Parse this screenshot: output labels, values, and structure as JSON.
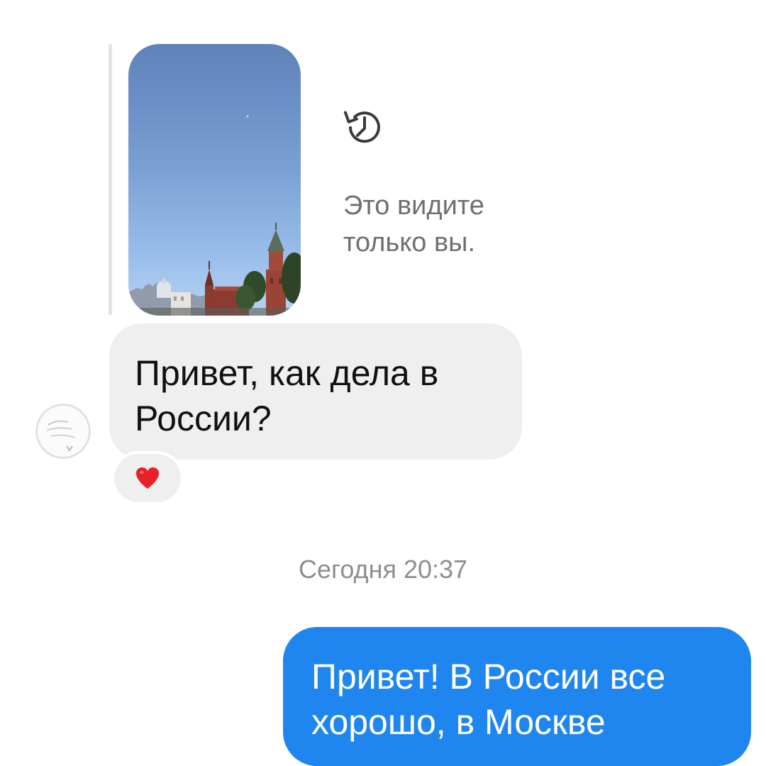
{
  "story": {
    "thumbnail_icon": "moscow-skyline-photo",
    "notice_icon": "history-clock-icon",
    "notice_text": "Это видите\nтолько вы."
  },
  "messages": [
    {
      "direction": "incoming",
      "text": "Привет, как дела в России?",
      "reaction": "❤️"
    },
    {
      "direction": "outgoing",
      "text": "Привет! В России все хорошо, в Москве"
    }
  ],
  "timestamp": "Сегодня 20:37",
  "colors": {
    "incoming_bubble": "#efefef",
    "outgoing_bubble": "#1f86ef",
    "secondary_text": "#6f6f6f",
    "heart": "#e8202a"
  }
}
